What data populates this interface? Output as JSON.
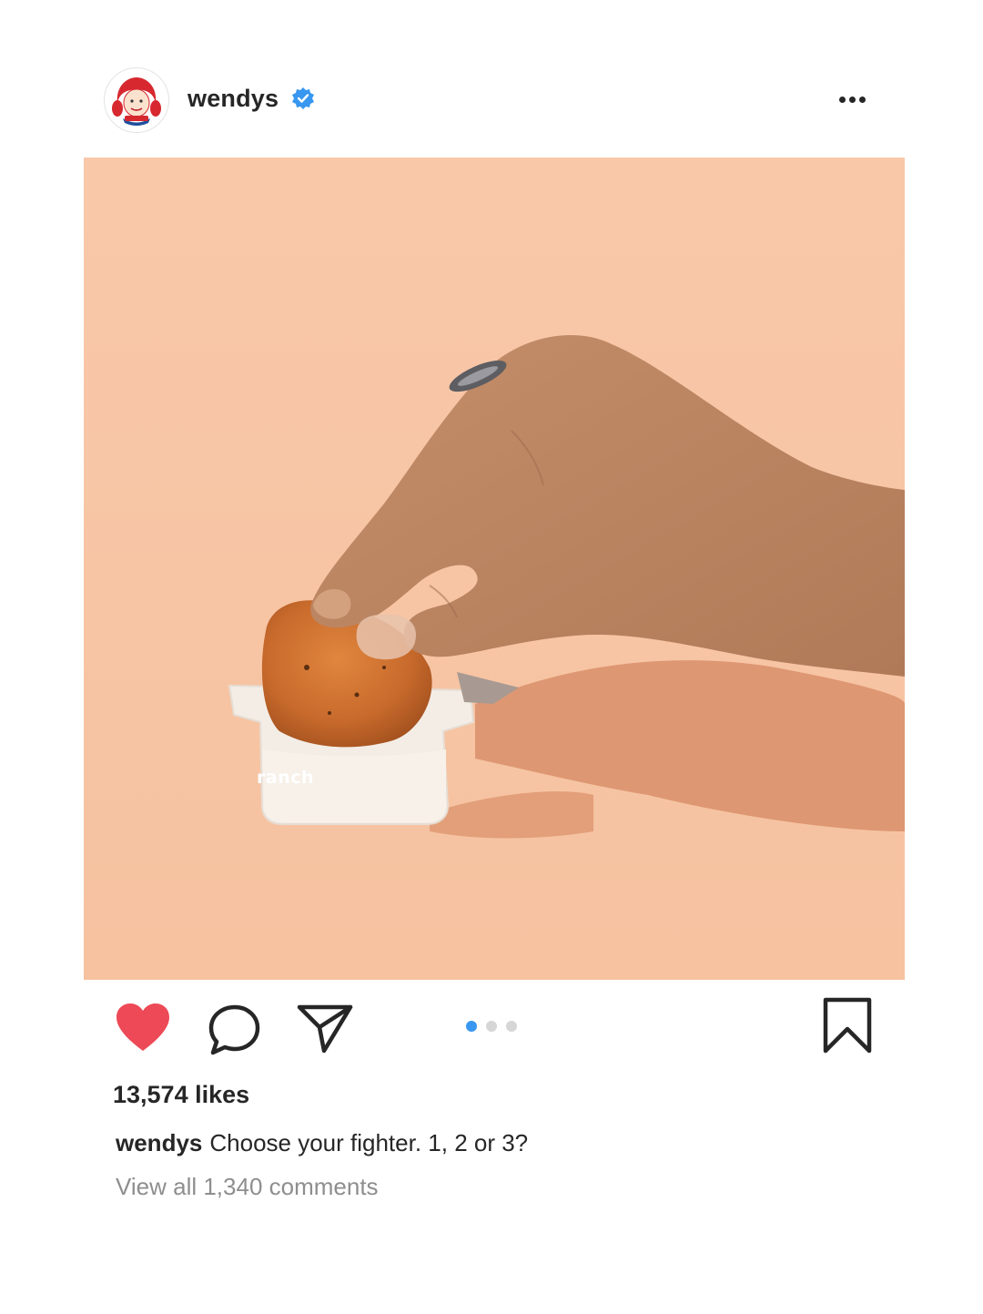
{
  "post": {
    "username": "wendys",
    "verified": true,
    "avatar_icon": "wendys-logo-avatar",
    "photo_label": "ranch",
    "carousel": {
      "count": 3,
      "active_index": 0
    },
    "likes_text": "13,574 likes",
    "caption_username": "wendys",
    "caption_text": "Choose your fighter. 1, 2 or 3?",
    "view_comments_text": "View all 1,340 comments"
  },
  "icons": {
    "like": "heart-icon",
    "comment": "comment-bubble-icon",
    "share": "paper-plane-icon",
    "save": "bookmark-icon",
    "more": "more-options-icon",
    "verified": "verified-badge-icon"
  },
  "colors": {
    "like": "#ed4956",
    "verified": "#3897f0",
    "carousel_active": "#3897f0",
    "carousel_inactive": "#d6d6d6",
    "photo_background": "#f7c4a3",
    "text_primary": "#262626",
    "text_secondary": "#8e8e8e"
  }
}
